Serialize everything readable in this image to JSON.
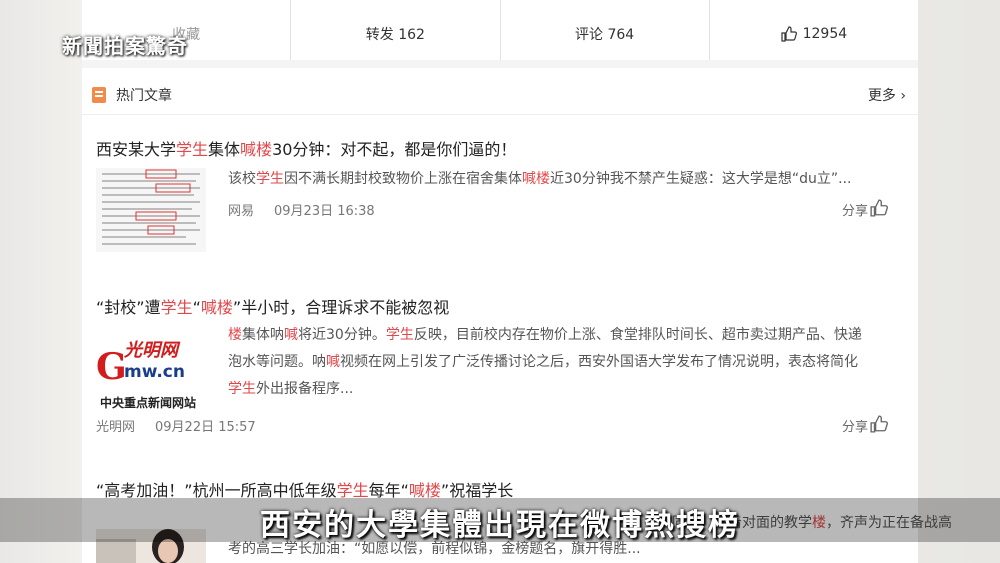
{
  "watermark": "新聞拍案驚奇",
  "actions": {
    "collect": "收藏",
    "repost": "转发 162",
    "comment": "评论 764",
    "likes": "12954"
  },
  "section": {
    "title": "热门文章",
    "more": "更多"
  },
  "articles": [
    {
      "title_parts": [
        "西安某大学",
        "学生",
        "集体",
        "喊楼",
        "30分钟：对不起，都是你们逼的！"
      ],
      "summary_parts": [
        "该校",
        "学生",
        "因不满长期封校致物价上涨在宿舍集体",
        "喊楼",
        "近30分钟我不禁产生疑惑：这大学是想“du立”..."
      ],
      "source": "网易",
      "time": "09月23日 16:38",
      "share": "分享"
    },
    {
      "title_parts": [
        "“封校”遭",
        "学生",
        "“",
        "喊楼",
        "”半小时，合理诉求不能被忽视"
      ],
      "summary_line1": [
        "楼",
        "集体呐",
        "喊",
        "将近30分钟。",
        "学生",
        "反映，目前校内存在物价上涨、食堂排队时间长、超市卖过期产品、快递"
      ],
      "summary_line2": [
        "泡水等问题。呐",
        "喊",
        "视频在网上引发了广泛传播讨论之后，西安外国语大学发布了情况说明，表态将简化"
      ],
      "summary_line3": [
        "学生",
        "外出报备程序..."
      ],
      "logo_text": "光明网",
      "logo_domain": "mw.cn",
      "logo_letter": "G",
      "logo_caption": "中央重点新闻网站",
      "source": "光明网",
      "time": "09月22日 15:57",
      "share": "分享"
    },
    {
      "title_parts": [
        "“高考加油！”杭州一所高中低年级",
        "学生",
        "每年“",
        "喊楼",
        "”祝福学长"
      ],
      "summary_line1": [
        "同学，向着对面的教学",
        "楼",
        "，齐声为正在备战高"
      ],
      "summary_line2": "考的高三学长加油：“如愿以偿，前程似锦，金榜题名，旗开得胜..."
    }
  ],
  "subtitle": "西安的大學集體出現在微博熱搜榜",
  "colors": {
    "highlight": "#e2474a",
    "accent_icon": "#f08b4a"
  }
}
